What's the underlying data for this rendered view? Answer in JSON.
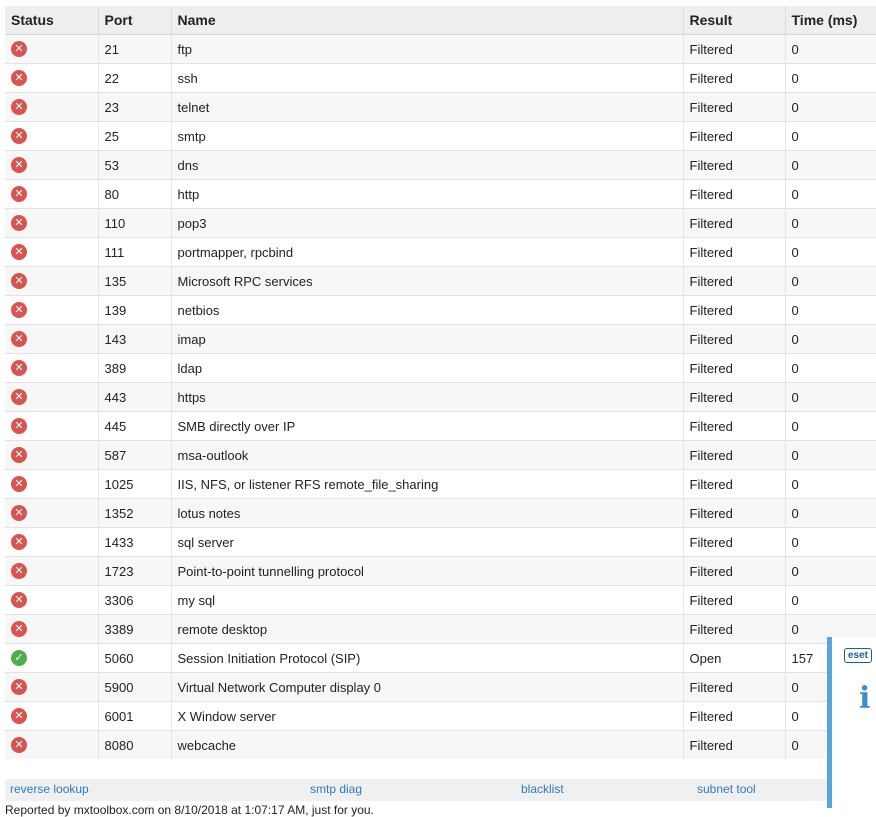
{
  "table": {
    "headers": [
      "Status",
      "Port",
      "Name",
      "Result",
      "Time (ms)"
    ],
    "rows": [
      {
        "status": "error",
        "port": "21",
        "name": "ftp",
        "result": "Filtered",
        "time": "0"
      },
      {
        "status": "error",
        "port": "22",
        "name": "ssh",
        "result": "Filtered",
        "time": "0"
      },
      {
        "status": "error",
        "port": "23",
        "name": "telnet",
        "result": "Filtered",
        "time": "0"
      },
      {
        "status": "error",
        "port": "25",
        "name": "smtp",
        "result": "Filtered",
        "time": "0"
      },
      {
        "status": "error",
        "port": "53",
        "name": "dns",
        "result": "Filtered",
        "time": "0"
      },
      {
        "status": "error",
        "port": "80",
        "name": "http",
        "result": "Filtered",
        "time": "0"
      },
      {
        "status": "error",
        "port": "110",
        "name": "pop3",
        "result": "Filtered",
        "time": "0"
      },
      {
        "status": "error",
        "port": "111",
        "name": "portmapper, rpcbind",
        "result": "Filtered",
        "time": "0"
      },
      {
        "status": "error",
        "port": "135",
        "name": "Microsoft RPC services",
        "result": "Filtered",
        "time": "0"
      },
      {
        "status": "error",
        "port": "139",
        "name": "netbios",
        "result": "Filtered",
        "time": "0"
      },
      {
        "status": "error",
        "port": "143",
        "name": "imap",
        "result": "Filtered",
        "time": "0"
      },
      {
        "status": "error",
        "port": "389",
        "name": "ldap",
        "result": "Filtered",
        "time": "0"
      },
      {
        "status": "error",
        "port": "443",
        "name": "https",
        "result": "Filtered",
        "time": "0"
      },
      {
        "status": "error",
        "port": "445",
        "name": "SMB directly over IP",
        "result": "Filtered",
        "time": "0"
      },
      {
        "status": "error",
        "port": "587",
        "name": "msa-outlook",
        "result": "Filtered",
        "time": "0"
      },
      {
        "status": "error",
        "port": "1025",
        "name": "IIS, NFS, or listener RFS remote_file_sharing",
        "result": "Filtered",
        "time": "0"
      },
      {
        "status": "error",
        "port": "1352",
        "name": "lotus notes",
        "result": "Filtered",
        "time": "0"
      },
      {
        "status": "error",
        "port": "1433",
        "name": "sql server",
        "result": "Filtered",
        "time": "0"
      },
      {
        "status": "error",
        "port": "1723",
        "name": "Point-to-point tunnelling protocol",
        "result": "Filtered",
        "time": "0"
      },
      {
        "status": "error",
        "port": "3306",
        "name": "my sql",
        "result": "Filtered",
        "time": "0"
      },
      {
        "status": "error",
        "port": "3389",
        "name": "remote desktop",
        "result": "Filtered",
        "time": "0"
      },
      {
        "status": "ok",
        "port": "5060",
        "name": "Session Initiation Protocol (SIP)",
        "result": "Open",
        "time": "157"
      },
      {
        "status": "error",
        "port": "5900",
        "name": "Virtual Network Computer display 0",
        "result": "Filtered",
        "time": "0"
      },
      {
        "status": "error",
        "port": "6001",
        "name": "X Window server",
        "result": "Filtered",
        "time": "0"
      },
      {
        "status": "error",
        "port": "8080",
        "name": "webcache",
        "result": "Filtered",
        "time": "0"
      }
    ]
  },
  "icons": {
    "error": "x-circle-icon",
    "ok": "check-circle-icon"
  },
  "colors": {
    "error": "#d9534f",
    "ok": "#4cae4c",
    "link": "#2a7cc0",
    "eset_border": "#5aa4dc"
  },
  "footer": {
    "links": [
      "reverse lookup",
      "smtp diag",
      "blacklist",
      "subnet tool"
    ],
    "report_text": "Reported by mxtoolbox.com on 8/10/2018 at 1:07:17 AM, just for you."
  },
  "eset_panel": {
    "logo_text": "eset",
    "info_icon": "info-icon"
  }
}
